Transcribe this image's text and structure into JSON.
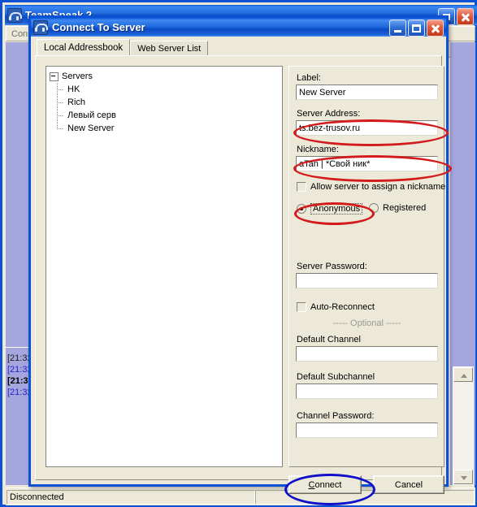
{
  "background_window": {
    "title": "TeamSpeak 2",
    "icon": "headset-icon",
    "menu": [
      {
        "label": "Conne"
      }
    ],
    "log_lines": [
      {
        "text": "[21:32",
        "style": "dark"
      },
      {
        "text": "[21:32",
        "style": "blue"
      },
      {
        "text": "[21:32",
        "style": "boldark"
      },
      {
        "text": "[21:32",
        "style": "blue"
      }
    ],
    "statusbar": {
      "left": "Disconnected",
      "right": ""
    },
    "controls": {
      "restore": "restore-button",
      "close": "close-button"
    }
  },
  "dialog": {
    "title": "Connect To Server",
    "icon": "headset-icon",
    "controls": {
      "minimize": "minimize-button",
      "maximize": "maximize-button",
      "close": "close-button"
    },
    "tabs": [
      {
        "label": "Local Addressbook",
        "active": true
      },
      {
        "label": "Web Server List",
        "active": false
      }
    ],
    "tree": {
      "root": "Servers",
      "expanded": true,
      "children": [
        "HK",
        "Rich",
        "Левый серв",
        "New Server"
      ]
    },
    "form": {
      "label_caption": "Label:",
      "label_value": "New Server",
      "server_address_caption": "Server Address:",
      "server_address_value": "ts.bez-trusov.ru",
      "nickname_caption": "Nickname:",
      "nickname_value": "aTan | *Свой ник*",
      "allow_assign_nickname": "Allow server to assign a nickname",
      "allow_assign_nickname_checked": false,
      "anonymous": "Anonymous",
      "anonymous_selected": true,
      "registered": "Registered",
      "registered_selected": false,
      "server_password_caption": "Server Password:",
      "server_password_value": "",
      "auto_reconnect": "Auto-Reconnect",
      "auto_reconnect_checked": false,
      "optional_divider": "----- Optional -----",
      "default_channel_caption": "Default Channel",
      "default_channel_value": "",
      "default_subchannel_caption": "Default Subchannel",
      "default_subchannel_value": "",
      "channel_password_caption": "Channel Password:",
      "channel_password_value": ""
    },
    "buttons": {
      "connect": "Connect",
      "connect_accel": "C",
      "cancel": "Cancel"
    }
  },
  "annotations": {
    "colors": {
      "red": "#d31b1b",
      "blue": "#1010c8"
    },
    "items": [
      {
        "name": "server-address-highlight",
        "color": "red"
      },
      {
        "name": "nickname-highlight",
        "color": "red"
      },
      {
        "name": "anonymous-highlight",
        "color": "red"
      },
      {
        "name": "connect-highlight",
        "color": "blue"
      }
    ]
  }
}
